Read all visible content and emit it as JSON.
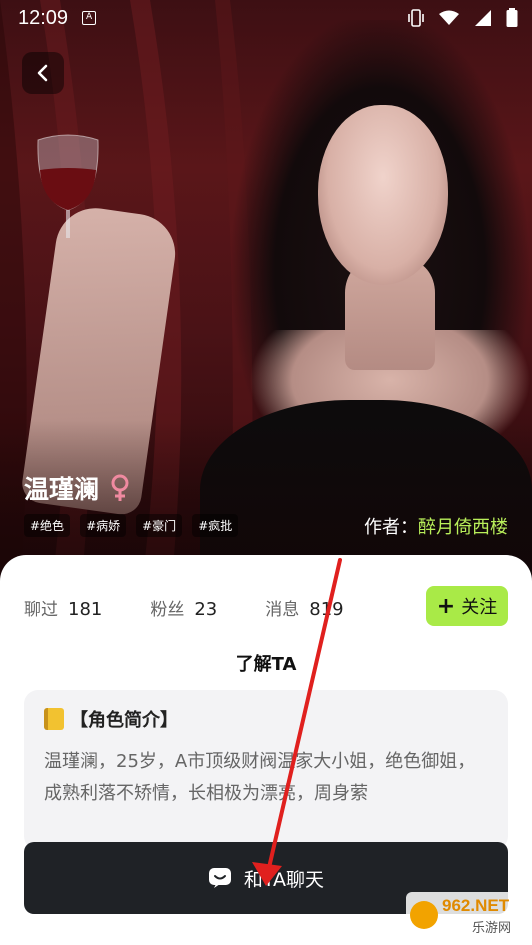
{
  "status_bar": {
    "time": "12:09"
  },
  "character": {
    "name": "温瑾澜",
    "gender_symbol": "♀",
    "tags": [
      "#绝色",
      "#病娇",
      "#豪门",
      "#疯批"
    ],
    "author_label": "作者：",
    "author_name": "醉月倚西楼"
  },
  "stats": [
    {
      "label": "聊过",
      "value": "181"
    },
    {
      "label": "粉丝",
      "value": "23"
    },
    {
      "label": "消息",
      "value": "819"
    }
  ],
  "follow_button": {
    "icon": "+",
    "label": "关注"
  },
  "section_title": "了解TA",
  "intro": {
    "heading": "【角色简介】",
    "text": "温瑾澜，25岁，A市顶级财阀温家大小姐，绝色御姐，成熟利落不矫情，长相极为漂亮，周身萦"
  },
  "chat_button": {
    "label": "和TA聊天"
  },
  "watermark": {
    "line1": "962.NET",
    "line2": "乐游网"
  },
  "colors": {
    "accent_green": "#a9ea47",
    "author_green": "#b9ef5a",
    "dark_button": "#1f2226",
    "annotation_red": "#e0201e"
  }
}
